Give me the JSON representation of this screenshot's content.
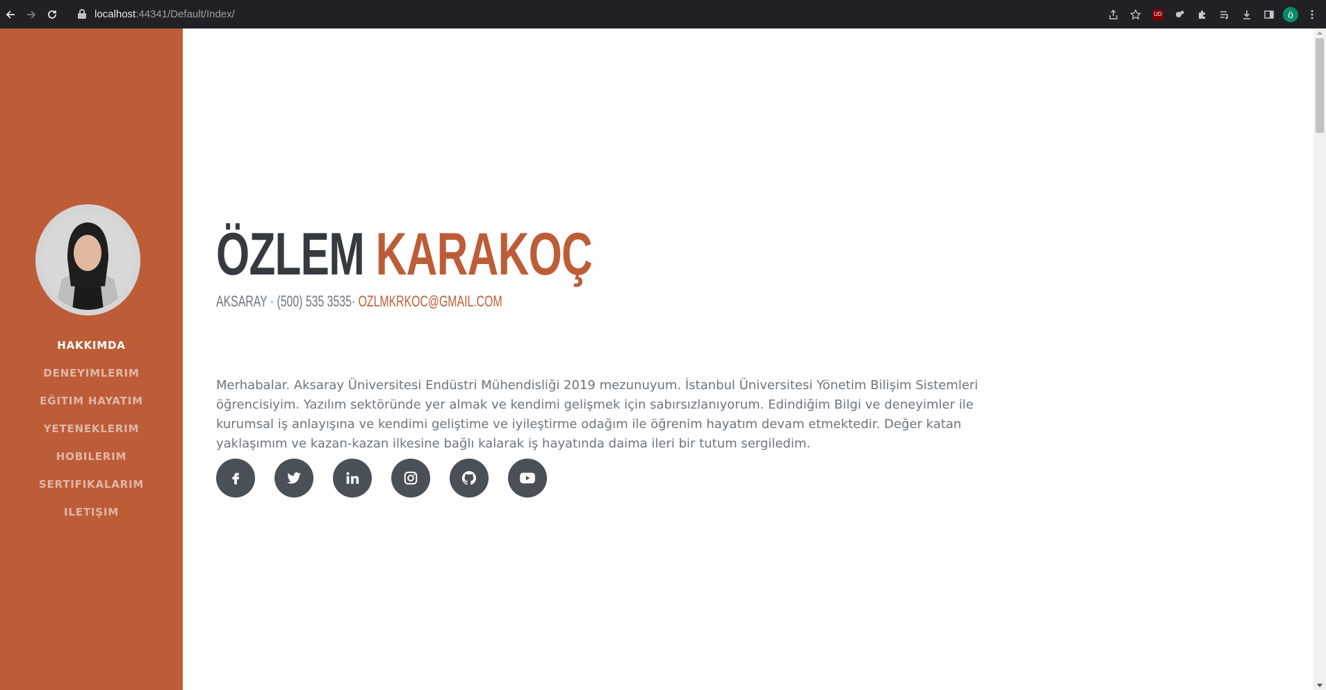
{
  "browser": {
    "url_host": "localhost",
    "url_rest": ":44341/Default/Index/",
    "profile_initial": "ö",
    "ext_badge": "UD"
  },
  "sidebar": {
    "nav": [
      {
        "label": "HAKKIMDA",
        "active": true
      },
      {
        "label": "DENEYIMLERIM"
      },
      {
        "label": "EĞITIM HAYATIM"
      },
      {
        "label": "YETENEKLERIM"
      },
      {
        "label": "HOBILERIM"
      },
      {
        "label": "SERTIFIKALARIM"
      },
      {
        "label": "ILETIŞIM"
      }
    ]
  },
  "main": {
    "first_name": "ÖZLEM",
    "last_name": "KARAKOÇ",
    "contact_prefix": "AKSARAY · (500) 535 3535·",
    "email": "ozlmkrkoc@gmail.com",
    "intro": "Merhabalar. Aksaray Üniversitesi Endüstri Mühendisliği 2019 mezunuyum. İstanbul Üniversitesi Yönetim Bilişim Sistemleri öğrencisiyim. Yazılım sektöründe yer almak ve kendimi gelişmek için sabırsızlanıyorum. Edindiğim Bilgi ve deneyimler ile kurumsal iş anlayışına ve kendimi geliştime ve iyileştirme odağım ile öğrenim hayatım devam etmektedir. Değer katan yaklaşımım ve kazan-kazan ilkesine bağlı kalarak iş hayatında daima ileri bir tutum sergiledim.",
    "social": [
      "facebook-icon",
      "twitter-icon",
      "linkedin-icon",
      "instagram-icon",
      "github-icon",
      "youtube-icon"
    ]
  },
  "colors": {
    "accent": "#bd5d38",
    "dark": "#343a40",
    "text": "#6c757d",
    "social_bg": "#495057"
  }
}
